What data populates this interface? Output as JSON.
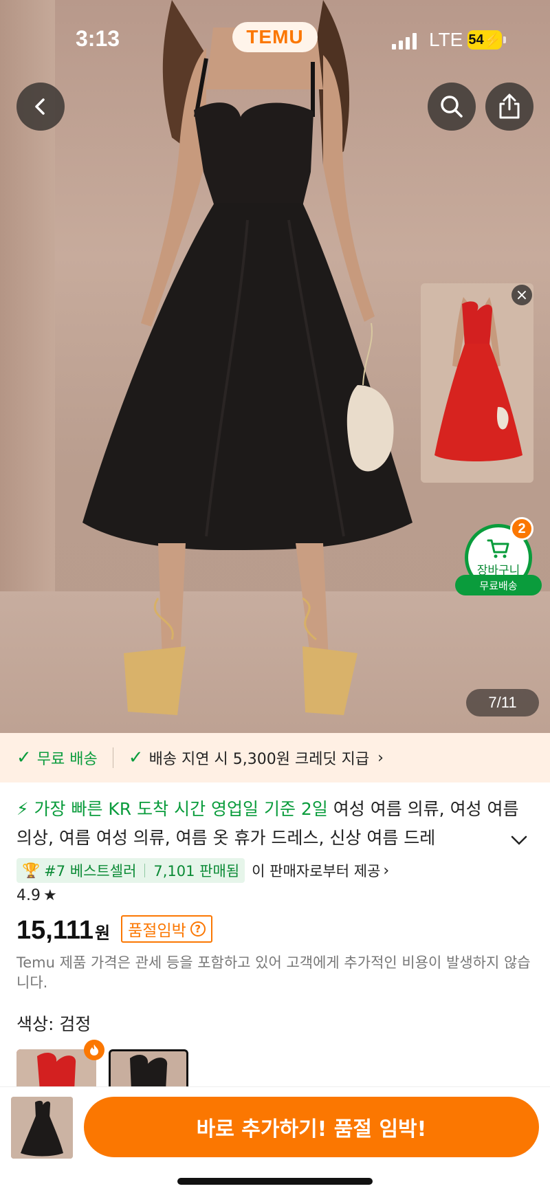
{
  "status_bar": {
    "time": "3:13",
    "app_logo": "TEMU",
    "network": "LTE",
    "battery": "54"
  },
  "hero": {
    "back_icon": "chevron-left-icon",
    "search_icon": "search-icon",
    "share_icon": "share-icon",
    "image_counter": "7/11",
    "floating_variant": {
      "color": "#d32020",
      "close": "×"
    },
    "cart": {
      "label": "장바구니",
      "count": "2",
      "shipping": "무료배송"
    }
  },
  "shipping": {
    "free": "무료 배송",
    "delay_credit": "배송 지연 시 5,300원 크레딧 지급"
  },
  "product": {
    "fast_delivery": "가장 빠른 KR 도착 시간 영업일 기준 2일",
    "title": "여성 여름 의류, 여성 여름 의상, 여름 여성 의류, 여름 옷 휴가 드레스, 신상 여름 드레",
    "bestseller": "#7 베스트셀러",
    "sold": "7,101 판매됨",
    "seller": "이 판매자로부터 제공",
    "rating": "4.9",
    "price": "15,111",
    "currency": "원",
    "soldout_tag": "품절임박",
    "price_note": "Temu 제품 가격은 관세 등을 포함하고 있어 고객에게 추가적인 비용이 발생하지 않습니다.",
    "color_label": "색상: 검정"
  },
  "bottom_bar": {
    "add_button": "바로 추가하기! 품절 임박!"
  },
  "colors": {
    "accent": "#fb7701",
    "green": "#0a9c3c",
    "dress": "#1d1a19",
    "dress_alt": "#d32020"
  }
}
